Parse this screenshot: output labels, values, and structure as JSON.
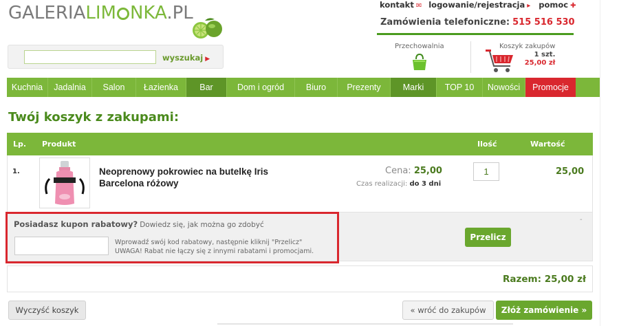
{
  "header": {
    "logo_part1": "GALERIA",
    "logo_part2": "LIM",
    "logo_part3": "NKA",
    "logo_part4": ".PL",
    "links": {
      "contact": "kontakt",
      "login": "logowanie/rejestracja",
      "help": "pomoc"
    },
    "phone_label": "Zamówienia telefoniczne:",
    "phone_number": "515 516 530"
  },
  "search": {
    "value": "",
    "button_label": "wyszukaj"
  },
  "storage": {
    "label": "Przechowalnia"
  },
  "cart": {
    "label": "Koszyk zakupów",
    "qty": "1 szt.",
    "amount": "25,00 zł"
  },
  "nav": {
    "items": [
      {
        "label": "Kuchnia"
      },
      {
        "label": "Jadalnia"
      },
      {
        "label": "Salon"
      },
      {
        "label": "Łazienka"
      },
      {
        "label": "Bar"
      },
      {
        "label": "Dom i ogród"
      },
      {
        "label": "Biuro"
      },
      {
        "label": "Prezenty"
      },
      {
        "label": "Marki"
      },
      {
        "label": "TOP 10"
      },
      {
        "label": "Nowości"
      },
      {
        "label": "Promocje"
      }
    ]
  },
  "page_title": "Twój koszyk z zakupami:",
  "table": {
    "headers": {
      "lp": "Lp.",
      "product": "Produkt",
      "qty": "Ilość",
      "value": "Wartość"
    },
    "rows": [
      {
        "lp": "1.",
        "name": "Neoprenowy pokrowiec na butelkę Iris Barcelona różowy",
        "price_label": "Cena:",
        "price": "25,00",
        "lead_label": "Czas realizacji:",
        "lead_time": "do 3 dni",
        "qty": "1",
        "value": "25,00"
      }
    ]
  },
  "coupon": {
    "question": "Posiadasz kupon rabatowy?",
    "how_text": "Dowiedz się, jak można go zdobyć",
    "value": "",
    "hint_line1": "Wprowadź swój kod rabatowy, następnie kliknij \"Przelicz\"",
    "hint_line2": "UWAGA! Rabat nie łączy się z innymi rabatami i promocjami.",
    "dash": "-"
  },
  "buttons": {
    "recalc": "Przelicz",
    "clear": "Wyczyść koszyk",
    "back": "« wróć do zakupów",
    "order": "Złóż zamówienie »"
  },
  "summary": {
    "label": "Razem:",
    "value": "25,00 zł"
  },
  "colors": {
    "green": "#7cb73a",
    "dark_green": "#4a8a1c",
    "red": "#d9272e"
  }
}
